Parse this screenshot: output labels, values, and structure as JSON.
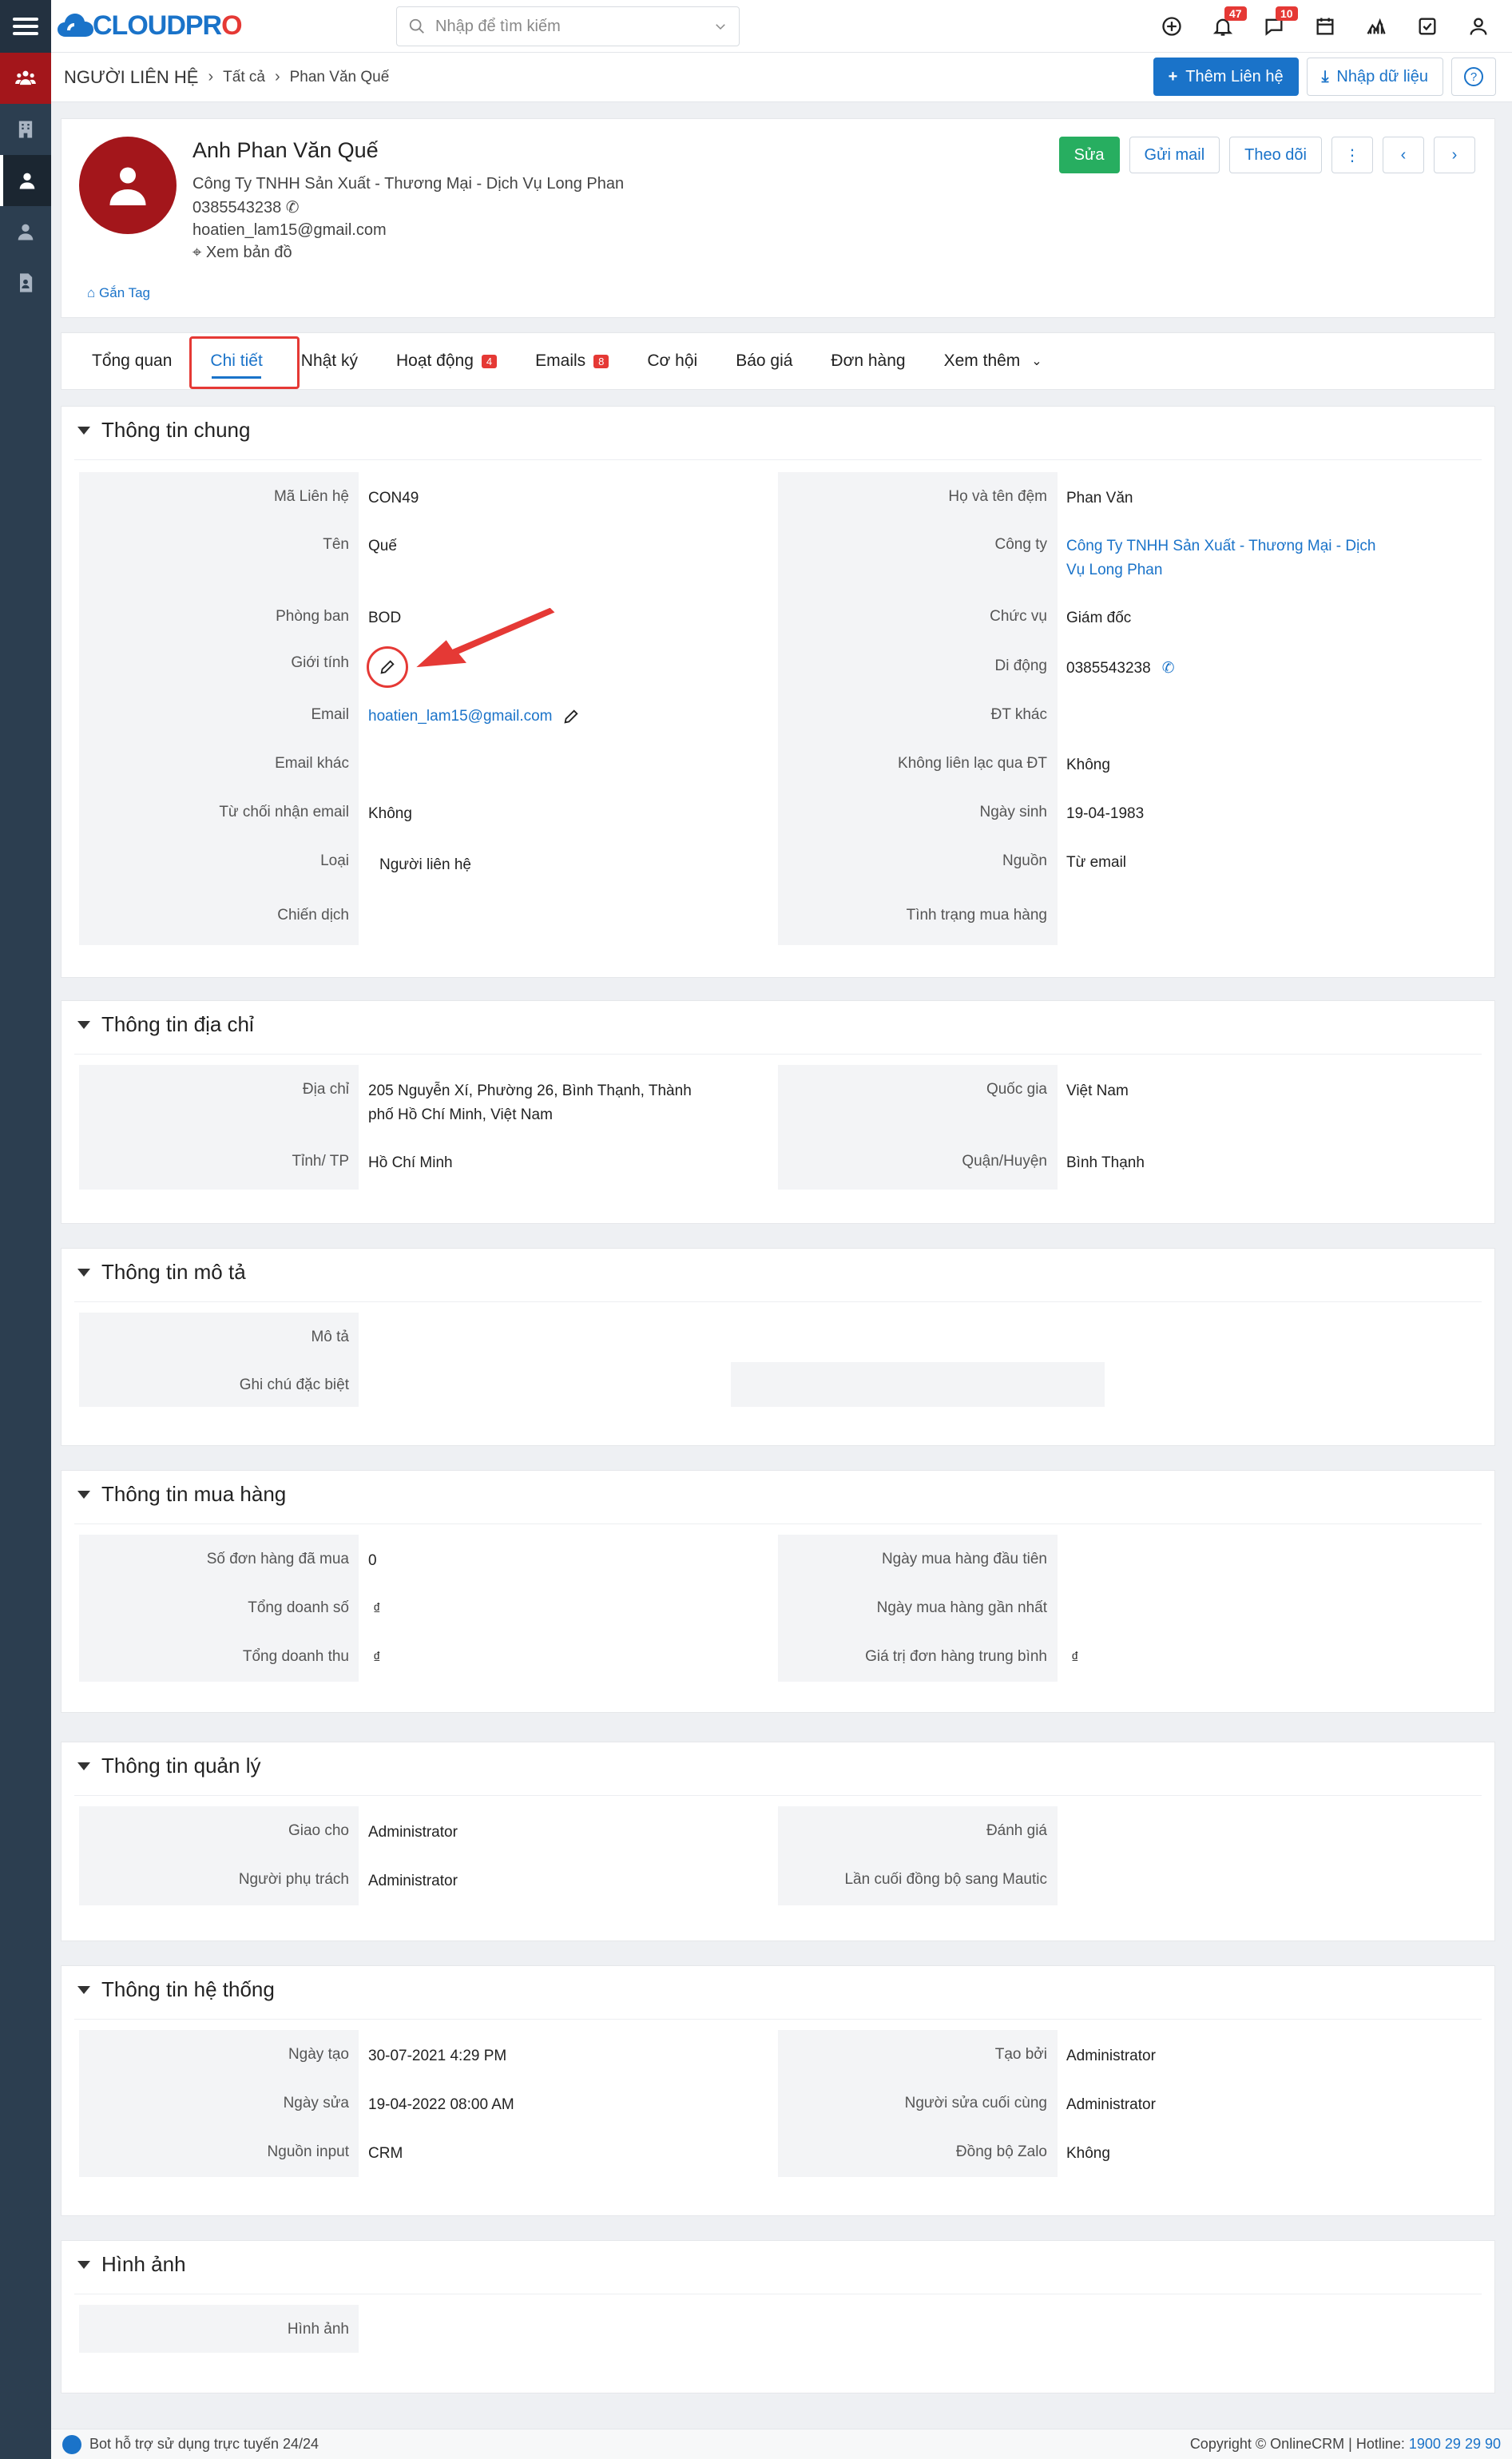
{
  "search": {
    "placeholder": "Nhập để tìm kiếm"
  },
  "notifications": {
    "bell_count": "47",
    "chat_count": "10"
  },
  "breadcrumb": {
    "module": "NGƯỜI LIÊN HỆ",
    "filter": "Tất cả",
    "record": "Phan Văn Quế"
  },
  "header_actions": {
    "add": "Thêm Liên hệ",
    "import": "Nhập dữ liệu",
    "help": "?"
  },
  "profile": {
    "name": "Anh Phan Văn Quế",
    "company": "Công Ty TNHH Sản Xuất - Thương Mại - Dịch Vụ Long Phan",
    "phone": "0385543238",
    "email": "hoatien_lam15@gmail.com",
    "map": "Xem bản đồ",
    "tag": "Gắn Tag",
    "actions": {
      "edit": "Sửa",
      "send_mail": "Gửi mail",
      "follow": "Theo dõi"
    }
  },
  "tabs": [
    {
      "label": "Tổng quan"
    },
    {
      "label": "Chi tiết"
    },
    {
      "label": "Nhật ký"
    },
    {
      "label": "Hoạt động",
      "badge": "4"
    },
    {
      "label": "Emails",
      "badge": "8"
    },
    {
      "label": "Cơ hội"
    },
    {
      "label": "Báo giá"
    },
    {
      "label": "Đơn hàng"
    },
    {
      "label": "Xem thêm"
    }
  ],
  "general": {
    "title": "Thông tin chung",
    "left": [
      {
        "label": "Mã Liên hệ",
        "value": "CON49"
      },
      {
        "label": "Tên",
        "value": "Quế"
      },
      {
        "label": "Phòng ban",
        "value": "BOD"
      },
      {
        "label": "Giới tính",
        "value": ""
      },
      {
        "label": "Email",
        "value": "hoatien_lam15@gmail.com"
      },
      {
        "label": "Email khác",
        "value": ""
      },
      {
        "label": "Từ chối nhận email",
        "value": "Không"
      },
      {
        "label": "Loại",
        "value": "Người liên hệ"
      },
      {
        "label": "Chiến dịch",
        "value": ""
      }
    ],
    "right": [
      {
        "label": "Họ và tên đệm",
        "value": "Phan Văn"
      },
      {
        "label": "Công ty",
        "value": "Công Ty TNHH Sản Xuất - Thương Mại - Dịch",
        "value2": "Vụ Long Phan"
      },
      {
        "label": "Chức vụ",
        "value": "Giám đốc"
      },
      {
        "label": "Di động",
        "value": "0385543238"
      },
      {
        "label": "ĐT khác",
        "value": ""
      },
      {
        "label": "Không liên lạc qua ĐT",
        "value": "Không"
      },
      {
        "label": "Ngày sinh",
        "value": "19-04-1983"
      },
      {
        "label": "Nguồn",
        "value": "Từ email"
      },
      {
        "label": "Tình trạng mua hàng",
        "value": ""
      }
    ]
  },
  "address": {
    "title": "Thông tin địa chỉ",
    "left": [
      {
        "label": "Địa chỉ",
        "value": "205 Nguyễn Xí, Phường 26, Bình Thạnh, Thành",
        "value2": "phố Hồ Chí Minh, Việt Nam"
      },
      {
        "label": "Tỉnh/ TP",
        "value": "Hồ Chí Minh"
      }
    ],
    "right": [
      {
        "label": "Quốc gia",
        "value": "Việt Nam"
      },
      {
        "label": "Quận/Huyện",
        "value": "Bình Thạnh"
      }
    ]
  },
  "description": {
    "title": "Thông tin mô tả",
    "left": [
      {
        "label": "Mô tả",
        "value": ""
      },
      {
        "label": "Ghi chú đặc biệt",
        "value": ""
      }
    ]
  },
  "purchase": {
    "title": "Thông tin mua hàng",
    "left": [
      {
        "label": "Số đơn hàng đã mua",
        "value": "0"
      },
      {
        "label": "Tổng doanh số",
        "value": "₫"
      },
      {
        "label": "Tổng doanh thu",
        "value": "₫"
      }
    ],
    "right": [
      {
        "label": "Ngày mua hàng đầu tiên",
        "value": ""
      },
      {
        "label": "Ngày mua hàng gần nhất",
        "value": ""
      },
      {
        "label": "Giá trị đơn hàng trung bình",
        "value": "₫"
      }
    ]
  },
  "management": {
    "title": "Thông tin quản lý",
    "left": [
      {
        "label": "Giao cho",
        "value": "Administrator"
      },
      {
        "label": "Người phụ trách",
        "value": "Administrator"
      }
    ],
    "right": [
      {
        "label": "Đánh giá",
        "value": ""
      },
      {
        "label": "Lần cuối đồng bộ sang Mautic",
        "value": ""
      }
    ]
  },
  "system": {
    "title": "Thông tin hệ thống",
    "left": [
      {
        "label": "Ngày tạo",
        "value": "30-07-2021 4:29 PM"
      },
      {
        "label": "Ngày sửa",
        "value": "19-04-2022 08:00 AM"
      },
      {
        "label": "Nguồn input",
        "value": "CRM"
      }
    ],
    "right": [
      {
        "label": "Tạo bởi",
        "value": "Administrator"
      },
      {
        "label": "Người sửa cuối cùng",
        "value": "Administrator"
      },
      {
        "label": "Đồng bộ Zalo",
        "value": "Không"
      }
    ]
  },
  "images": {
    "title": "Hình ảnh",
    "left": [
      {
        "label": "Hình ảnh",
        "value": ""
      }
    ]
  },
  "footer": {
    "bot": "Bot hỗ trợ sử dụng trực tuyến 24/24",
    "copyright": "Copyright © OnlineCRM | Hotline:",
    "hotline": "1900 29 29 90"
  },
  "accent": "#1a73c9",
  "brand_red": "#a3161b"
}
